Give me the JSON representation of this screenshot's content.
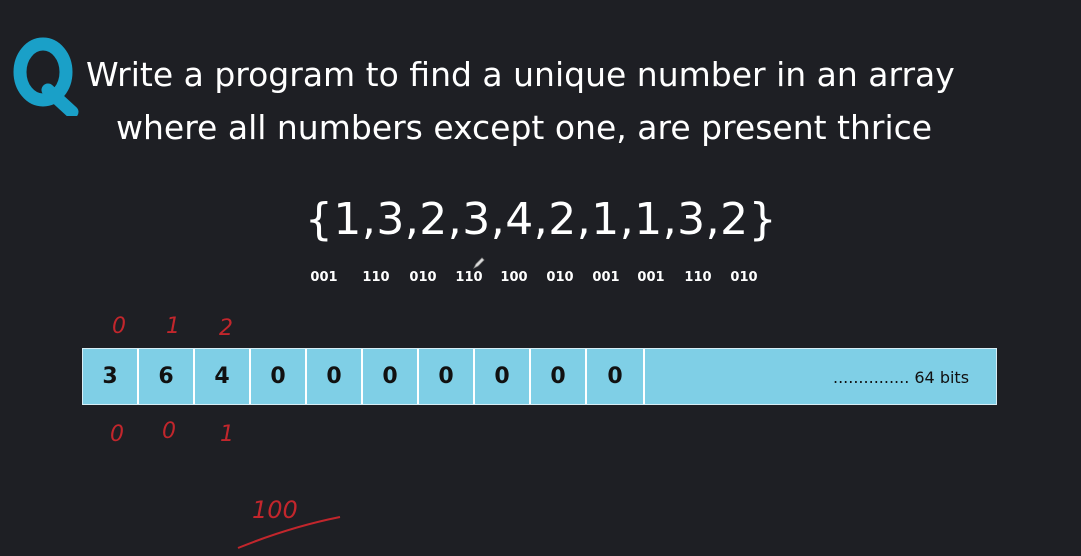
{
  "logo": {
    "letter": "Q",
    "color": "#1aa0c8"
  },
  "question": {
    "line1": "Write a program to find a unique number in an array",
    "line2": "where all numbers except one, are present thrice"
  },
  "array_text": "{1,3,2,3,4,2,1,1,3,2}",
  "binary_codes": [
    "001",
    "110",
    "010",
    "110",
    "100",
    "010",
    "001",
    "001",
    "110",
    "010"
  ],
  "bit_cells": [
    "3",
    "6",
    "4",
    "0",
    "0",
    "0",
    "0",
    "0",
    "0",
    "0"
  ],
  "bits_label": "............... 64 bits",
  "handwriting": {
    "index_labels": [
      "0",
      "1",
      "2"
    ],
    "remainders": [
      "0",
      "0",
      "1"
    ],
    "result": "100",
    "ink_color": "#c2262c"
  },
  "colors": {
    "background": "#1e1f24",
    "strip": "#7fcfe6",
    "text": "#ffffff"
  }
}
